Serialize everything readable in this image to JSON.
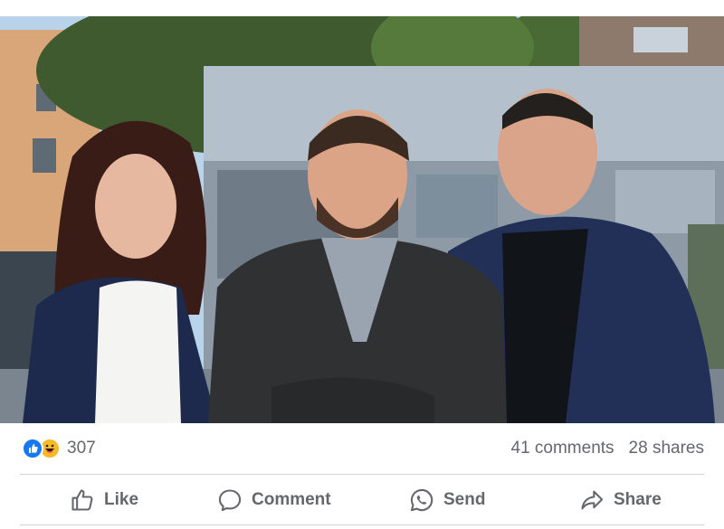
{
  "post": {
    "photo_alt": "Three people standing in front of a building",
    "reactions": {
      "icons": [
        "like-icon",
        "haha-icon"
      ],
      "count": "307",
      "colors": {
        "like": "#1877f2",
        "haha": "#f7b928"
      }
    },
    "stats": {
      "comments": "41 comments",
      "shares": "28 shares"
    },
    "actions": {
      "like": "Like",
      "comment": "Comment",
      "send": "Send",
      "share": "Share"
    },
    "colors": {
      "text": "#65676b",
      "divider": "#ced0d4"
    }
  }
}
